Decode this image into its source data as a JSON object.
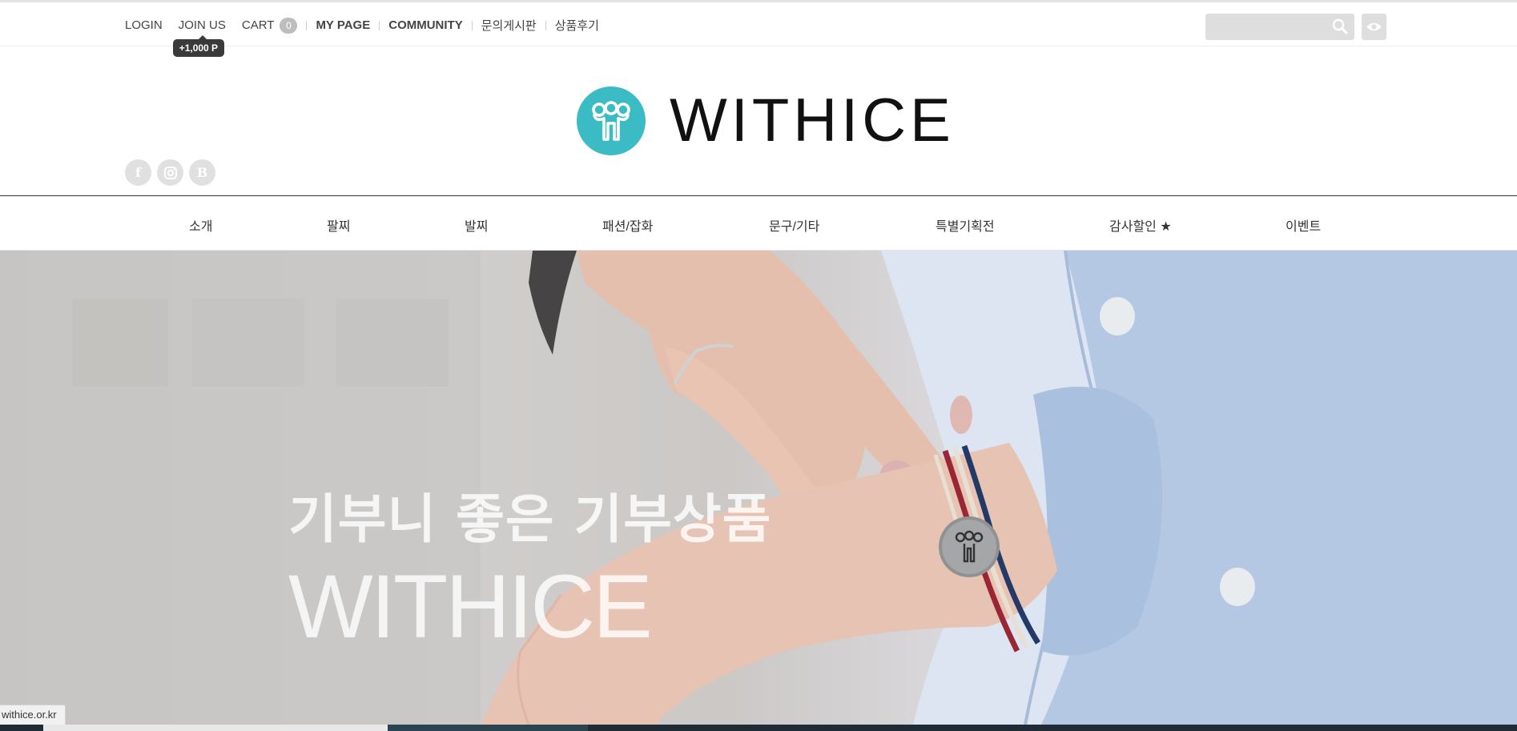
{
  "top_nav": {
    "login": "LOGIN",
    "join_us": "JOIN US",
    "join_tooltip": "+1,000 P",
    "cart": "CART",
    "cart_count": "0",
    "my_page": "MY PAGE",
    "community": "COMMUNITY",
    "inquiry_board": "문의게시판",
    "reviews": "상품후기"
  },
  "search": {
    "value": "",
    "placeholder": ""
  },
  "logo": {
    "text": "WITHICE",
    "brand_color": "#3bbcc4"
  },
  "socials": [
    {
      "icon": "facebook-icon",
      "glyph": "f"
    },
    {
      "icon": "instagram-icon",
      "glyph": ""
    },
    {
      "icon": "blog-icon",
      "glyph": "B"
    }
  ],
  "main_nav": [
    {
      "label": "소개"
    },
    {
      "label": "팔찌"
    },
    {
      "label": "발찌"
    },
    {
      "label": "패션/잡화"
    },
    {
      "label": "문구/기타"
    },
    {
      "label": "특별기획전"
    },
    {
      "label": "감사할인 ★"
    },
    {
      "label": "이벤트"
    }
  ],
  "hero": {
    "headline": "기부니 좋은  기부상품",
    "brand": "WITHICE"
  },
  "status_bar": {
    "url": "withice.or.kr"
  }
}
